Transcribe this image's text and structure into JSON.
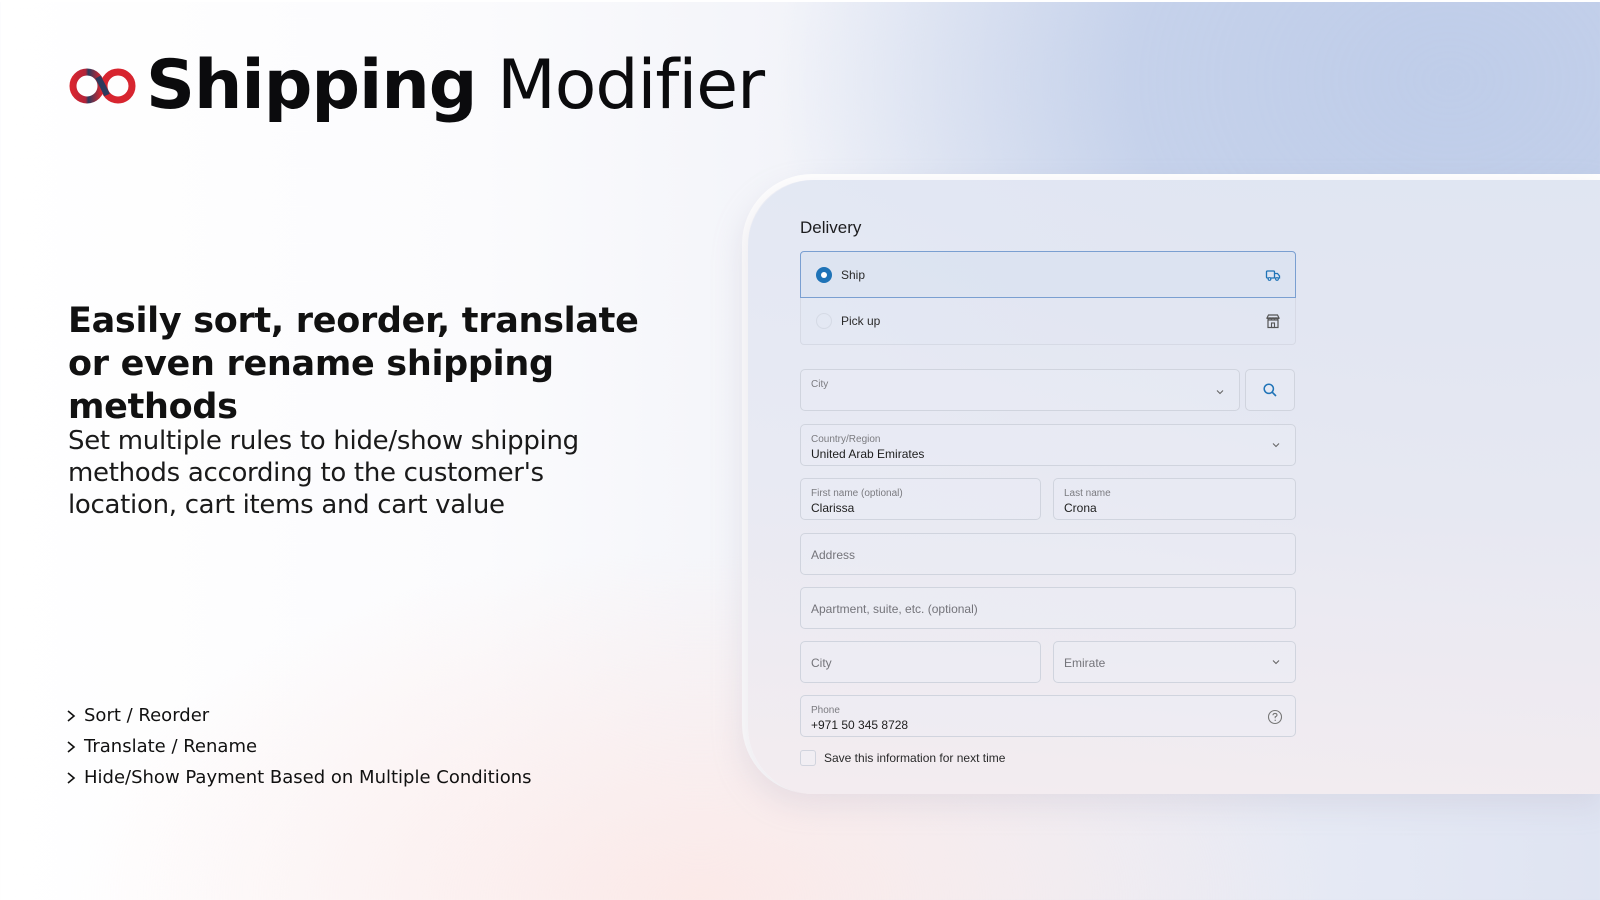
{
  "brand": {
    "logo_icon": "infinity-logo-icon",
    "title_bold": "Shipping",
    "title_light": "Modifier",
    "colors": {
      "logo_red": "#d7252f",
      "logo_navy": "#2c3a5c"
    }
  },
  "headline": "Easily sort, reorder, translate or even rename shipping methods",
  "subtext": "Set multiple rules to hide/show shipping methods according to the customer's location, cart items and cart value",
  "features": [
    {
      "icon": "chevron-right-icon",
      "label": "Sort / Reorder"
    },
    {
      "icon": "chevron-right-icon",
      "label": "Translate / Rename"
    },
    {
      "icon": "chevron-right-icon",
      "label": "Hide/Show Payment Based on Multiple Conditions"
    }
  ],
  "checkout": {
    "section_title": "Delivery",
    "delivery_options": [
      {
        "label": "Ship",
        "selected": true,
        "icon": "truck-icon"
      },
      {
        "label": "Pick up",
        "selected": false,
        "icon": "store-icon"
      }
    ],
    "city_lookup": {
      "label": "City",
      "value": "",
      "search_icon": "search-icon"
    },
    "country": {
      "label": "Country/Region",
      "value": "United Arab Emirates"
    },
    "first_name": {
      "label": "First name (optional)",
      "value": "Clarissa"
    },
    "last_name": {
      "label": "Last name",
      "value": "Crona"
    },
    "address": {
      "placeholder": "Address"
    },
    "apartment": {
      "placeholder": "Apartment, suite, etc. (optional)"
    },
    "city": {
      "placeholder": "City"
    },
    "emirate": {
      "placeholder": "Emirate"
    },
    "phone": {
      "label": "Phone",
      "value": "+971 50 345 8728",
      "help_icon": "help-circle-icon"
    },
    "save_info": {
      "label": "Save this information for next time",
      "checked": false
    },
    "accent_color": "#1f73b7"
  }
}
